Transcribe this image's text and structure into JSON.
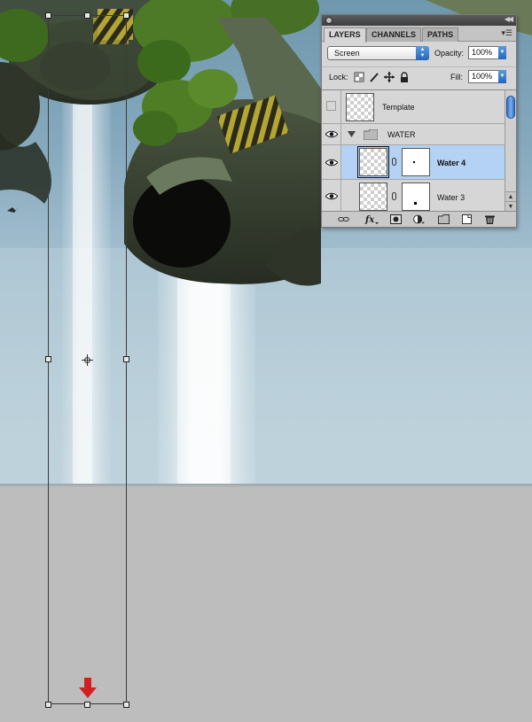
{
  "layers_panel": {
    "tabs": [
      {
        "label": "LAYERS",
        "active": true
      },
      {
        "label": "CHANNELS",
        "active": false
      },
      {
        "label": "PATHS",
        "active": false
      }
    ],
    "blend_mode": "Screen",
    "opacity_label": "Opacity:",
    "opacity_value": "100%",
    "lock_label": "Lock:",
    "fill_label": "Fill:",
    "fill_value": "100%",
    "layers": [
      {
        "name": "Template",
        "type": "layer",
        "visible": false,
        "selected": false
      },
      {
        "name": "WATER",
        "type": "group",
        "visible": true,
        "expanded": true,
        "selected": false
      },
      {
        "name": "Water 4",
        "type": "layer",
        "visible": true,
        "selected": true,
        "has_mask": true
      },
      {
        "name": "Water 3",
        "type": "layer",
        "visible": true,
        "selected": false,
        "has_mask": true
      }
    ],
    "footer_icons": [
      "link-layers-icon",
      "fx-icon",
      "layer-mask-icon",
      "adjustment-layer-icon",
      "new-group-icon",
      "new-layer-icon",
      "trash-icon"
    ]
  },
  "colors": {
    "selected_row": "#b4d2f4",
    "accent_blue": "#2366bd",
    "arrow_red": "#d21f1f",
    "workspace_gray": "#bdbdbd"
  }
}
